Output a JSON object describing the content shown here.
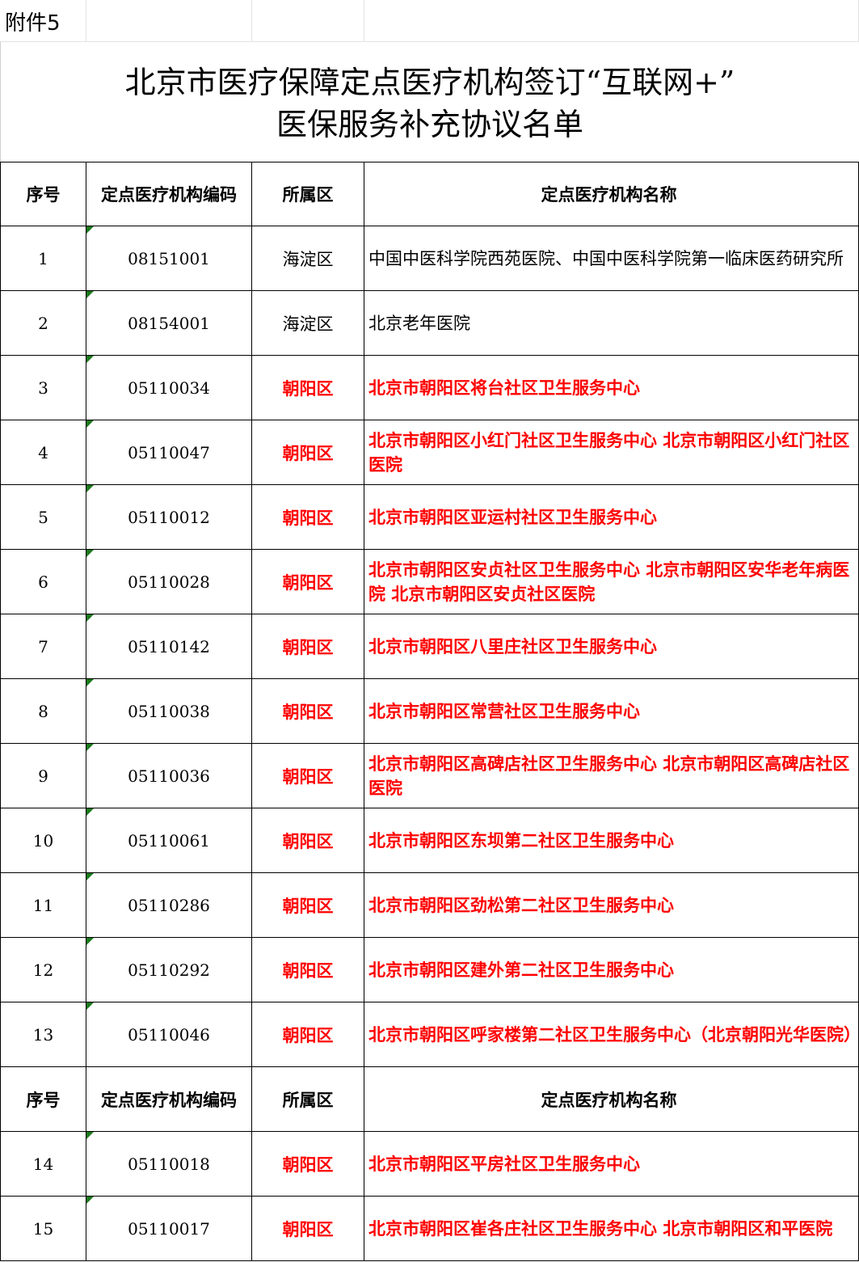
{
  "attachment_label": "附件5",
  "title": {
    "line1": "北京市医疗保障定点医疗机构签订“互联网+”",
    "line2": "医保服务补充协议名单"
  },
  "headers": {
    "seq": "序号",
    "code": "定点医疗机构编码",
    "district": "所属区",
    "name": "定点医疗机构名称"
  },
  "rows": [
    {
      "seq": "1",
      "code": "08151001",
      "district": "海淀区",
      "name": "中国中医科学院西苑医院、中国中医科学院第一临床医药研究所",
      "highlight": false
    },
    {
      "seq": "2",
      "code": "08154001",
      "district": "海淀区",
      "name": "北京老年医院",
      "highlight": false
    },
    {
      "seq": "3",
      "code": "05110034",
      "district": "朝阳区",
      "name": "北京市朝阳区将台社区卫生服务中心",
      "highlight": true
    },
    {
      "seq": "4",
      "code": "05110047",
      "district": "朝阳区",
      "name": "北京市朝阳区小红门社区卫生服务中心 北京市朝阳区小红门社区医院",
      "highlight": true
    },
    {
      "seq": "5",
      "code": "05110012",
      "district": "朝阳区",
      "name": "北京市朝阳区亚运村社区卫生服务中心",
      "highlight": true
    },
    {
      "seq": "6",
      "code": "05110028",
      "district": "朝阳区",
      "name": "北京市朝阳区安贞社区卫生服务中心 北京市朝阳区安华老年病医院 北京市朝阳区安贞社区医院",
      "highlight": true
    },
    {
      "seq": "7",
      "code": "05110142",
      "district": "朝阳区",
      "name": "北京市朝阳区八里庄社区卫生服务中心",
      "highlight": true
    },
    {
      "seq": "8",
      "code": "05110038",
      "district": "朝阳区",
      "name": "北京市朝阳区常营社区卫生服务中心",
      "highlight": true
    },
    {
      "seq": "9",
      "code": "05110036",
      "district": "朝阳区",
      "name": "北京市朝阳区高碑店社区卫生服务中心 北京市朝阳区高碑店社区医院",
      "highlight": true
    },
    {
      "seq": "10",
      "code": "05110061",
      "district": "朝阳区",
      "name": "北京市朝阳区东坝第二社区卫生服务中心",
      "highlight": true
    },
    {
      "seq": "11",
      "code": "05110286",
      "district": "朝阳区",
      "name": "北京市朝阳区劲松第二社区卫生服务中心",
      "highlight": true
    },
    {
      "seq": "12",
      "code": "05110292",
      "district": "朝阳区",
      "name": "北京市朝阳区建外第二社区卫生服务中心",
      "highlight": true
    },
    {
      "seq": "13",
      "code": "05110046",
      "district": "朝阳区",
      "name": "北京市朝阳区呼家楼第二社区卫生服务中心（北京朝阳光华医院）",
      "highlight": true
    },
    {
      "seq": "14",
      "code": "05110018",
      "district": "朝阳区",
      "name": "北京市朝阳区平房社区卫生服务中心",
      "highlight": true
    },
    {
      "seq": "15",
      "code": "05110017",
      "district": "朝阳区",
      "name": "北京市朝阳区崔各庄社区卫生服务中心 北京市朝阳区和平医院",
      "highlight": true
    }
  ],
  "colors": {
    "highlight_text": "#ff0000",
    "comment_marker": "#1a7a1a",
    "grid": "#000000"
  }
}
